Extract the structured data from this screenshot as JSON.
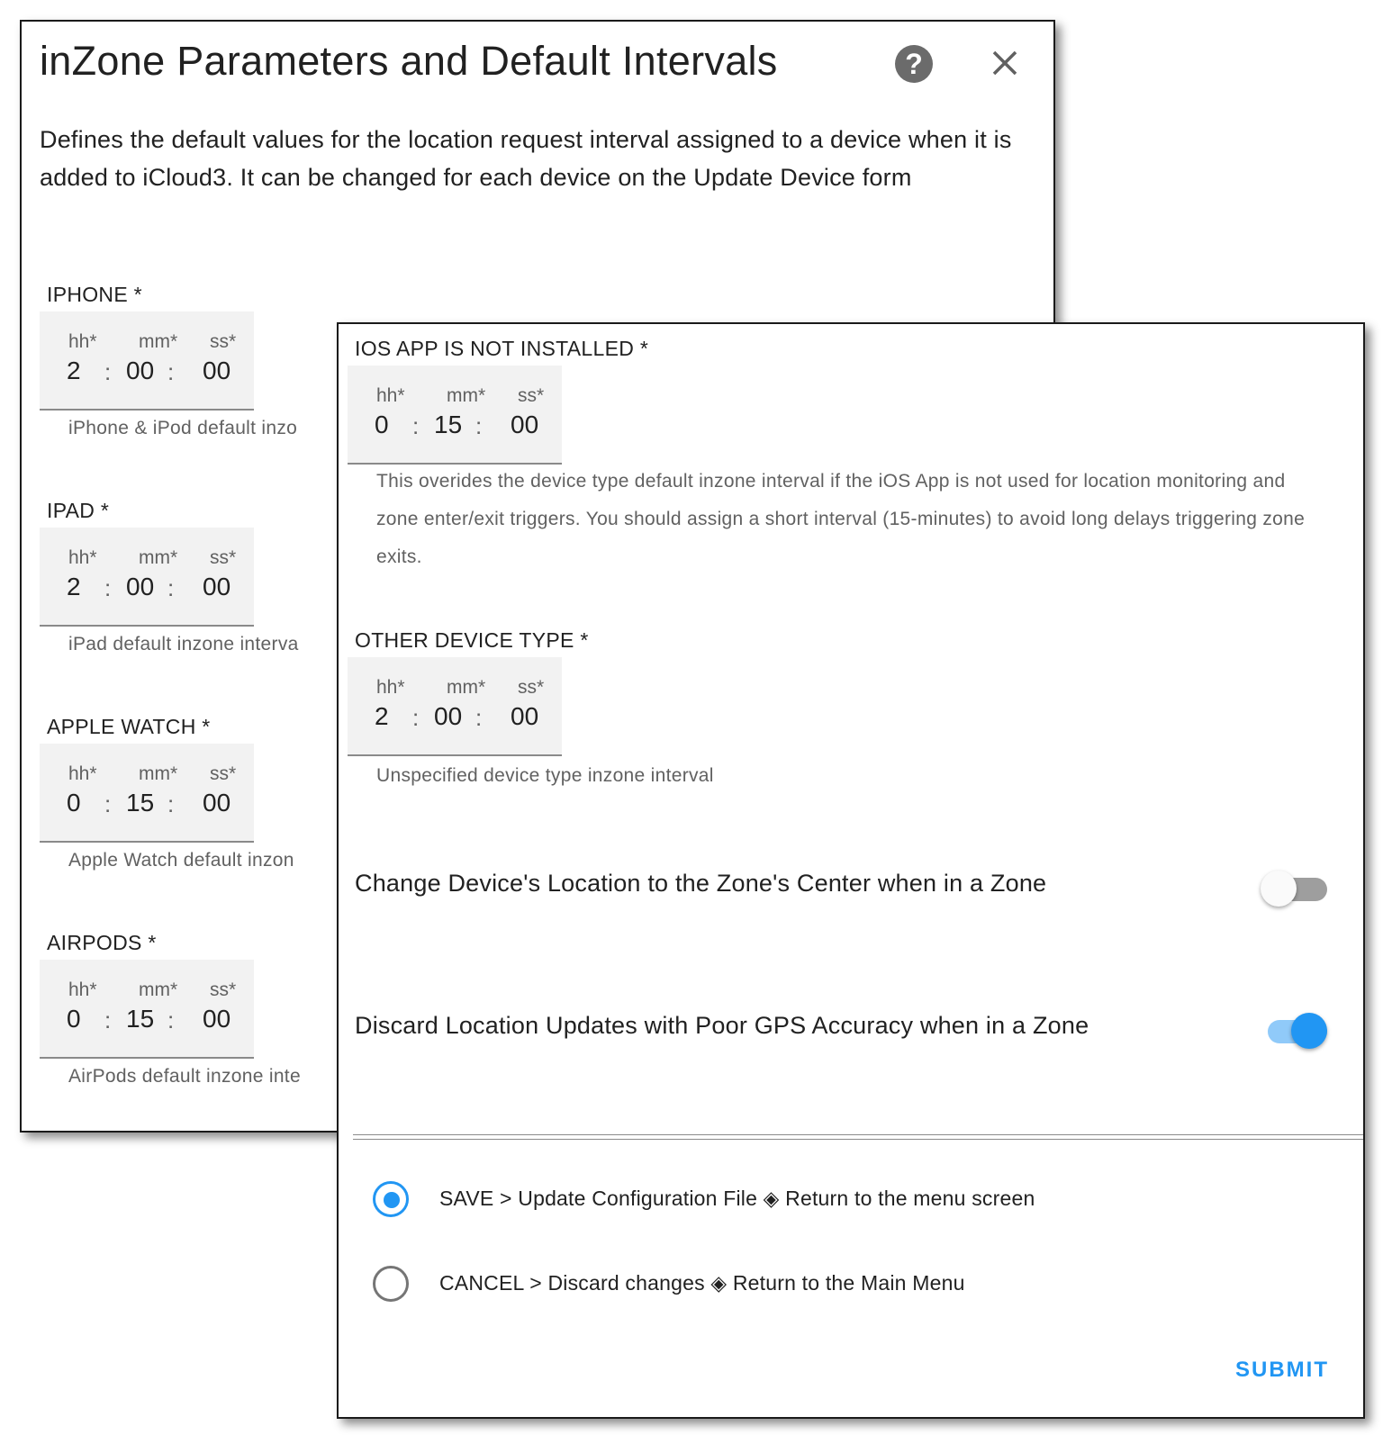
{
  "back_dialog": {
    "title": "inZone Parameters and Default Intervals",
    "description": "Defines the default values for the location request interval assigned to a device when it is added to iCloud3. It can be changed for each device on the Update Device form",
    "help_icon": "help-circle-icon",
    "close_icon": "close-icon",
    "fields": [
      {
        "label": "IPHONE *",
        "hh": "2",
        "mm": "00",
        "ss": "00",
        "helper": "iPhone & iPod default inzo"
      },
      {
        "label": "IPAD *",
        "hh": "2",
        "mm": "00",
        "ss": "00",
        "helper": "iPad default inzone interva"
      },
      {
        "label": "APPLE WATCH *",
        "hh": "0",
        "mm": "15",
        "ss": "00",
        "helper": "Apple Watch default inzon"
      },
      {
        "label": "AIRPODS *",
        "hh": "0",
        "mm": "15",
        "ss": "00",
        "helper": "AirPods default inzone inte"
      }
    ]
  },
  "duration_labels": {
    "hh": "hh*",
    "mm": "mm*",
    "ss": "ss*",
    "sep": ":"
  },
  "front_dialog": {
    "fields": [
      {
        "label": "IOS APP IS NOT INSTALLED *",
        "hh": "0",
        "mm": "15",
        "ss": "00",
        "helper": "This overides the device type default inzone interval if the iOS App is not used for location monitoring and zone enter/exit triggers. You should assign a short interval (15-minutes) to avoid long delays triggering zone exits."
      },
      {
        "label": "OTHER DEVICE TYPE *",
        "hh": "2",
        "mm": "00",
        "ss": "00",
        "helper": "Unspecified device type inzone interval"
      }
    ],
    "toggles": [
      {
        "label": "Change Device's Location to the Zone's Center when in a Zone",
        "on": false
      },
      {
        "label": "Discard Location Updates with Poor GPS Accuracy when in a Zone",
        "on": true
      }
    ],
    "actions": [
      {
        "label": "SAVE > Update Configuration File ◈ Return to the menu screen",
        "selected": true
      },
      {
        "label": "CANCEL > Discard changes ◈ Return to the Main Menu",
        "selected": false
      }
    ],
    "submit_label": "SUBMIT"
  },
  "colors": {
    "accent": "#2196f3",
    "toggle_on_track": "#90caf9",
    "toggle_off_track": "#9e9e9e",
    "toggle_off_thumb": "#fafafa",
    "radio_off": "#757575"
  }
}
